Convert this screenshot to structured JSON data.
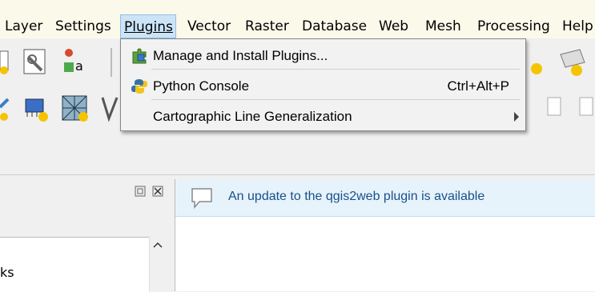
{
  "menubar": {
    "items": [
      {
        "label": "Layer",
        "underline_first": true
      },
      {
        "label": "Settings",
        "underline_first": true
      },
      {
        "label": "Plugins",
        "underline_first": true
      },
      {
        "label": "Vector",
        "underline_first": false
      },
      {
        "label": "Raster",
        "underline_first": true
      },
      {
        "label": "Database",
        "underline_first": true
      },
      {
        "label": "Web",
        "underline_first": true
      },
      {
        "label": "Mesh",
        "underline_first": true
      },
      {
        "label": "Processing",
        "underline_first": false
      },
      {
        "label": "Help",
        "underline_first": true
      }
    ]
  },
  "plugins_menu": {
    "items": [
      {
        "label": "Manage and Install Plugins...",
        "shortcut": "",
        "icon": "puzzle-icon"
      },
      {
        "label": "Python Console",
        "shortcut": "Ctrl+Alt+P",
        "icon": "python-icon"
      },
      {
        "label": "Cartographic Line Generalization",
        "shortcut": "",
        "icon": "",
        "submenu": true
      }
    ]
  },
  "message_bar": {
    "text": "An update to the qgis2web plugin is available",
    "icon": "speech-bubble-icon"
  },
  "left_panel": {
    "list_item": "ks"
  },
  "colors": {
    "menubar_bg": "#fbf9ea",
    "menu_highlight": "#cce4f7",
    "banner_bg": "#e6f3fb",
    "banner_text": "#1a4f8b"
  }
}
